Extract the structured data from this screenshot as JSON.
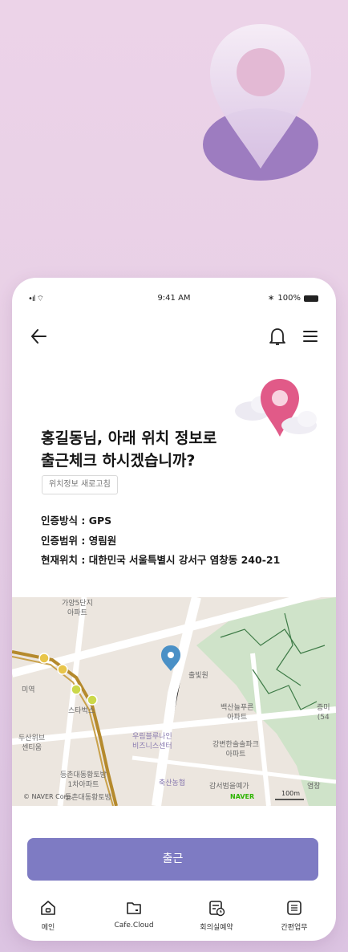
{
  "status_bar": {
    "time": "9:41 AM",
    "battery": "100%",
    "signal": "•ıl ⌔"
  },
  "header": {
    "title": "홍길동님, 아래 위치 정보로\n출근체크 하시겠습니까?"
  },
  "refresh_label": "위치정보 새로고침",
  "info": [
    {
      "label": "인증방식 : GPS"
    },
    {
      "label": "인증범위 : 영림원"
    },
    {
      "label": "현재위치 : 대한민국 서울특별시 강서구 염창동 240-21"
    }
  ],
  "map": {
    "labels": {
      "l1": "가양5단지\n아파트",
      "l2": "출빛원",
      "l3": "백산늘푸른\n아파트",
      "l4": "미역",
      "l5": "스타벅스",
      "l6": "두산위브\n센티움",
      "l7": "우림블루나인\n비즈니스센터",
      "l8": "강변한솔솔파크\n아파트",
      "l9": "등촌대동황토방\n1차아파트",
      "l10": "축산농협",
      "l11": "감서범을예가",
      "l12": "증미\n(54",
      "l13": "염창",
      "l14": "등촌대동황토방"
    },
    "copyright": "© NAVER Corp.",
    "logo": "NAVER",
    "scale": "100m",
    "accent": "#4a90c6"
  },
  "primary_button": {
    "label": "출근",
    "color": "#7e7bc3"
  },
  "tabs": [
    {
      "label": "메인",
      "icon": "home-icon"
    },
    {
      "label": "Cafe.Cloud",
      "icon": "cloud-folder-icon"
    },
    {
      "label": "회의실예약",
      "icon": "calendar-clock-icon"
    },
    {
      "label": "간편업무",
      "icon": "list-icon"
    }
  ]
}
